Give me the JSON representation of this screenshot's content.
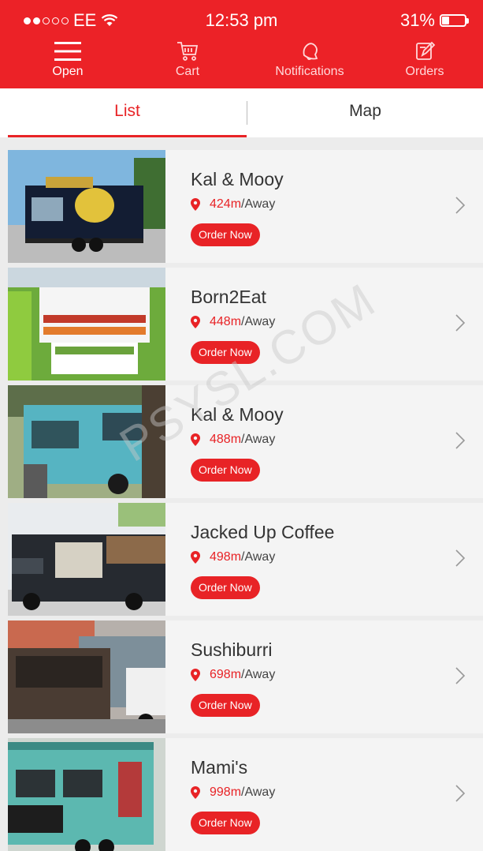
{
  "status_bar": {
    "carrier": "EE",
    "time": "12:53 pm",
    "battery": "31%",
    "battery_level": 0.31
  },
  "nav": [
    {
      "label": "Open",
      "icon": "menu-icon"
    },
    {
      "label": "Cart",
      "icon": "cart-icon"
    },
    {
      "label": "Notifications",
      "icon": "bell-icon"
    },
    {
      "label": "Orders",
      "icon": "orders-icon"
    }
  ],
  "tabs": {
    "list": "List",
    "map": "Map"
  },
  "trucks": [
    {
      "name": "Kal & Mooy",
      "distance": "424m",
      "suffix": "/Away",
      "cta": "Order Now"
    },
    {
      "name": "Born2Eat",
      "distance": "448m",
      "suffix": "/Away",
      "cta": "Order Now"
    },
    {
      "name": "Kal & Mooy",
      "distance": "488m",
      "suffix": "/Away",
      "cta": "Order Now"
    },
    {
      "name": "Jacked Up Coffee",
      "distance": "498m",
      "suffix": "/Away",
      "cta": "Order Now"
    },
    {
      "name": "Sushiburri",
      "distance": "698m",
      "suffix": "/Away",
      "cta": "Order Now"
    },
    {
      "name": "Mami's",
      "distance": "998m",
      "suffix": "/Away",
      "cta": "Order Now"
    }
  ],
  "watermark": "PSYSL.COM",
  "colors": {
    "brand": "#ec2227",
    "accent_text": "#e82326"
  }
}
